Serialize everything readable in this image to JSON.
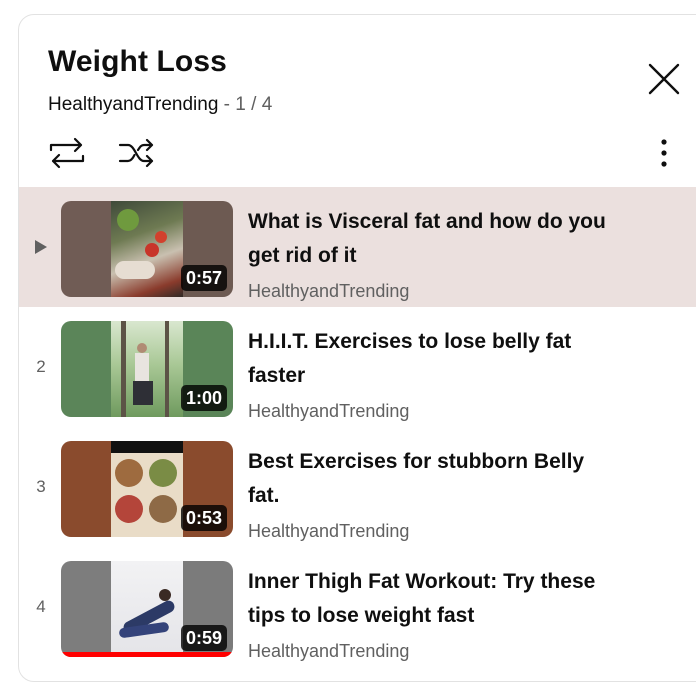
{
  "playlist": {
    "title": "Weight Loss",
    "channel": "HealthyandTrending",
    "position": " - 1 / 4"
  },
  "colors": {
    "active_row": "#ebe0de",
    "progress": "#ff0000",
    "text_primary": "#0f0f0f",
    "text_secondary": "#606060"
  },
  "icons": {
    "close": "close-icon",
    "loop": "loop-icon",
    "shuffle": "shuffle-icon",
    "more": "more-vertical-icon",
    "now_playing": "play-triangle-icon"
  },
  "videos": [
    {
      "index": "▶",
      "title": "What is Visceral fat and how do you get rid of it",
      "channel": "HealthyandTrending",
      "duration": "0:57",
      "watched_fraction": 0
    },
    {
      "index": "2",
      "title": "H.I.I.T. Exercises to lose belly fat faster",
      "channel": "HealthyandTrending",
      "duration": "1:00",
      "watched_fraction": 0
    },
    {
      "index": "3",
      "title": "Best Exercises for stubborn Belly fat.",
      "channel": "HealthyandTrending",
      "duration": "0:53",
      "watched_fraction": 0
    },
    {
      "index": "4",
      "title": "Inner Thigh Fat Workout: Try these tips to lose weight fast",
      "channel": "HealthyandTrending",
      "duration": "0:59",
      "watched_fraction": 1
    }
  ]
}
